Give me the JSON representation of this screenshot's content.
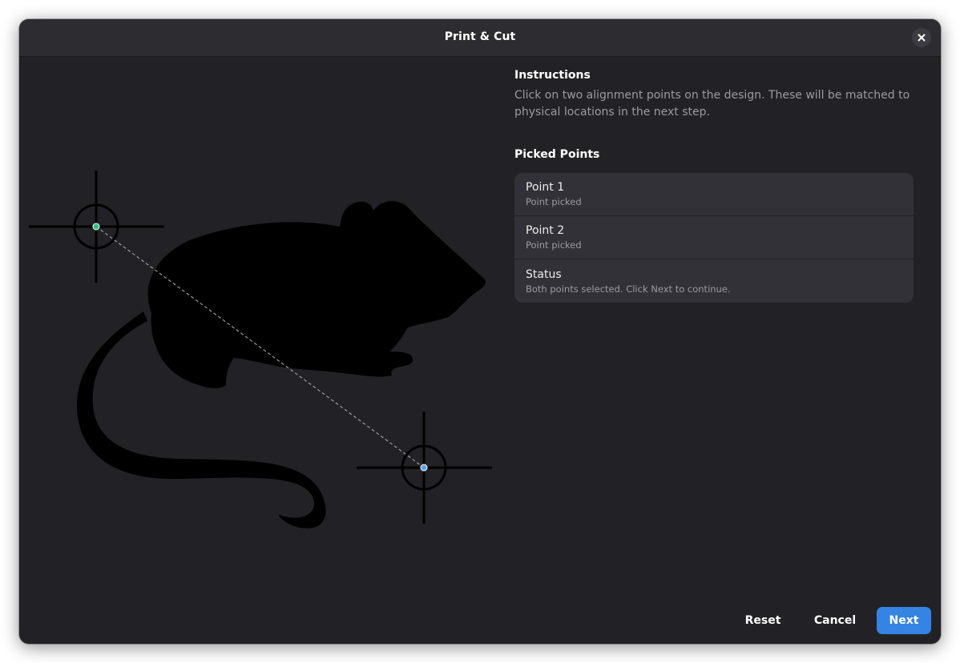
{
  "window": {
    "title": "Print & Cut",
    "close_icon": "close-icon"
  },
  "instructions": {
    "heading": "Instructions",
    "text": "Click on two alignment points on the design. These will be matched to physical locations in the next step."
  },
  "picked_points": {
    "heading": "Picked Points",
    "rows": [
      {
        "title": "Point 1",
        "subtitle": "Point picked"
      },
      {
        "title": "Point 2",
        "subtitle": "Point picked"
      },
      {
        "title": "Status",
        "subtitle": "Both points selected. Click Next to continue."
      }
    ]
  },
  "buttons": {
    "reset": "Reset",
    "cancel": "Cancel",
    "next": "Next"
  },
  "colors": {
    "accent": "#3584e4",
    "point1_marker": "#2ec27e",
    "point2_marker": "#62a0ea"
  }
}
